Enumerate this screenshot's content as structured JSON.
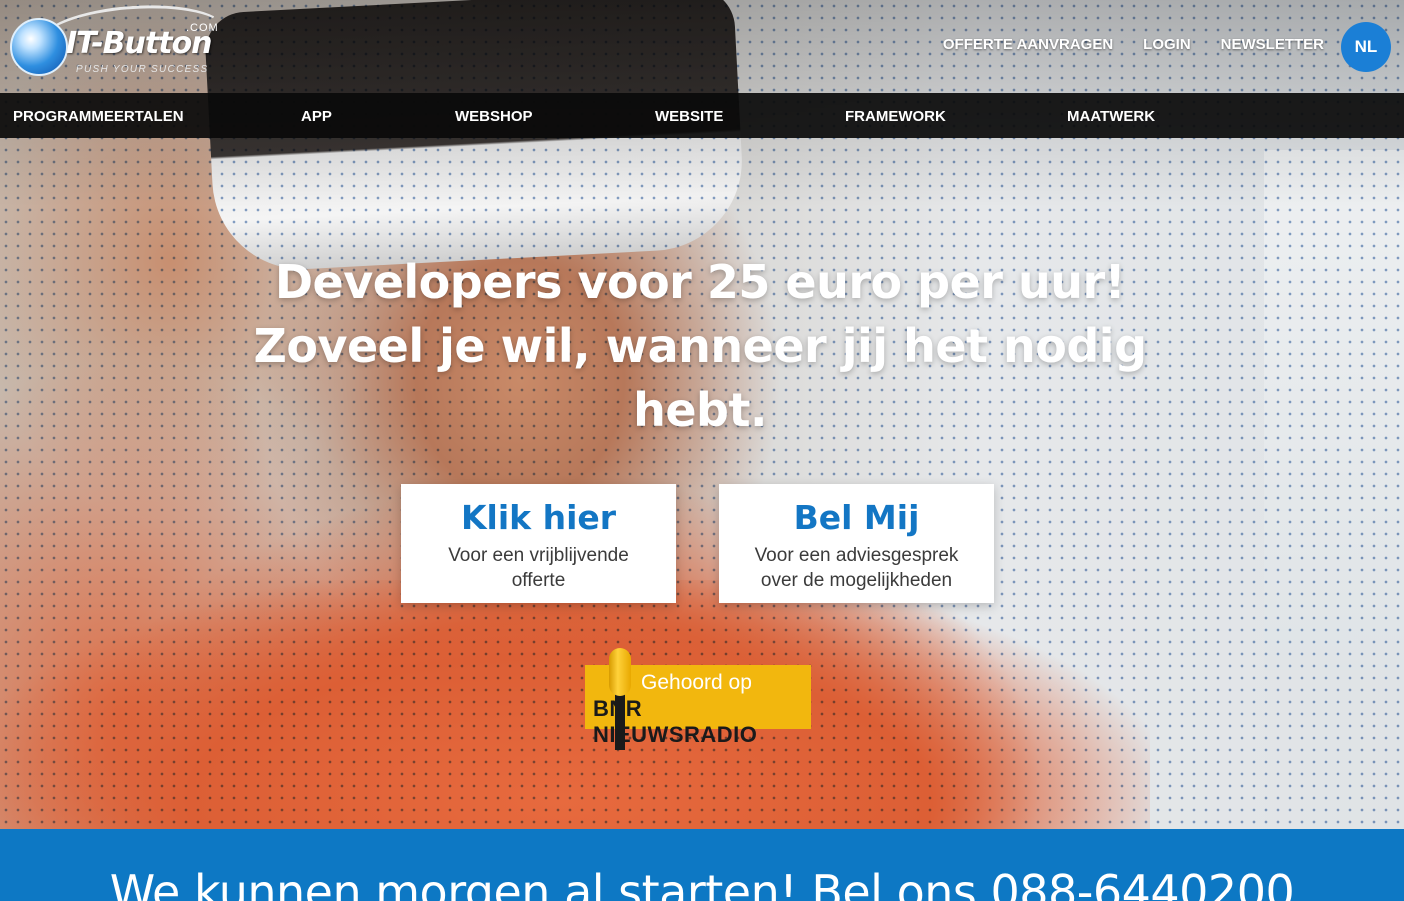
{
  "brand": {
    "name": "IT-Button",
    "domain_suffix": ".COM",
    "tagline": "PUSH YOUR SUCCESS"
  },
  "top_links": {
    "quote": "OFFERTE AANVRAGEN",
    "login": "LOGIN",
    "newsletter": "NEWSLETTER"
  },
  "language": "NL",
  "main_nav": {
    "items": [
      {
        "label": "PROGRAMMEERTALEN"
      },
      {
        "label": "APP"
      },
      {
        "label": "WEBSHOP"
      },
      {
        "label": "WEBSITE"
      },
      {
        "label": "FRAMEWORK"
      },
      {
        "label": "MAATWERK"
      }
    ]
  },
  "hero": {
    "headline": "Developers voor 25 euro per uur! Zoveel je wil, wanneer jij het nodig hebt.",
    "cta_left": {
      "title": "Klik hier",
      "subtitle": "Voor een vrijblijvende offerte"
    },
    "cta_right": {
      "title": "Bel Mij",
      "subtitle": "Voor een adviesgesprek over de mogelijkheden"
    }
  },
  "badge": {
    "line1": "Gehoord op",
    "line2": "BNR NIEUWSRADIO"
  },
  "callbar": {
    "text": "We kunnen morgen al starten! Bel ons 088-6440200"
  },
  "colors": {
    "accent_blue": "#1376c4",
    "callbar_blue": "#0d78c4",
    "nav_black": "#0a0a0a",
    "badge_yellow": "#f2b70e"
  }
}
